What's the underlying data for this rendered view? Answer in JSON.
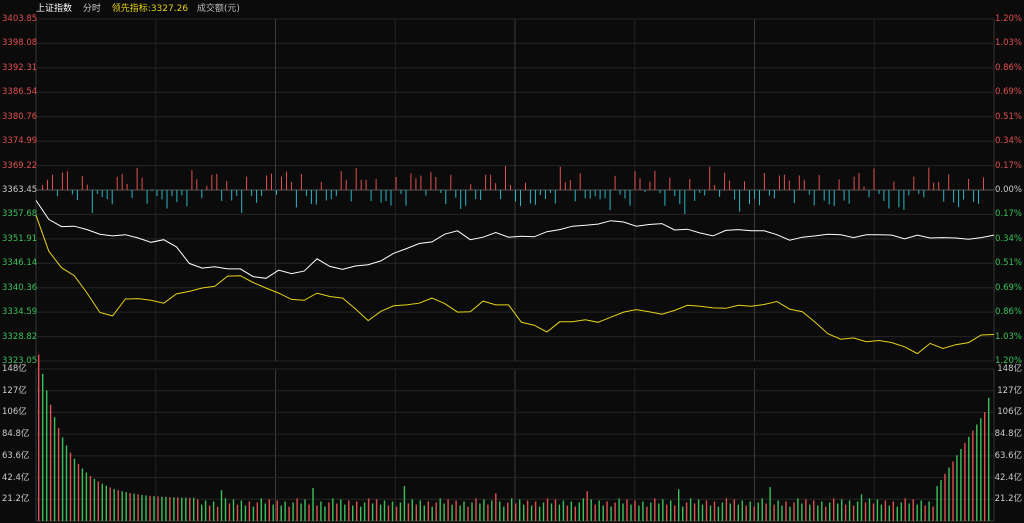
{
  "header": {
    "index_name": "上证指数",
    "mode": "分时",
    "leading_label": "领先指标:",
    "leading_value": "3327.26",
    "volume_label": "成交额(元)"
  },
  "colors": {
    "up": "#e05050",
    "down": "#2bb5c4",
    "index_line": "#ffffff",
    "leading_line": "#e6d21a",
    "vol_up": "#e05050",
    "vol_down": "#3cc05a"
  },
  "price_axis": {
    "left": [
      "3403.85",
      "3398.08",
      "3392.31",
      "3386.54",
      "3380.76",
      "3374.99",
      "3369.22",
      "3363.45",
      "3357.68",
      "3351.91",
      "3346.14",
      "3340.36",
      "3334.59",
      "3328.82",
      "3323.05"
    ],
    "right": [
      "1.20%",
      "1.03%",
      "0.86%",
      "0.69%",
      "0.51%",
      "0.34%",
      "0.17%",
      "0.00%",
      "0.17%",
      "0.34%",
      "0.51%",
      "0.69%",
      "0.86%",
      "1.03%",
      "1.20%"
    ]
  },
  "volume_axis": [
    "148亿",
    "127亿",
    "106亿",
    "84.8亿",
    "63.6亿",
    "42.4亿",
    "21.2亿"
  ],
  "chart_data": {
    "type": "line",
    "title": "上证指数 分时",
    "prev_close": 3363.45,
    "ylim": [
      3323.05,
      3403.85
    ],
    "series": [
      {
        "name": "上证指数",
        "values": [
          3361.0,
          3356.5,
          3354.8,
          3354.9,
          3354.1,
          3353.0,
          3352.6,
          3352.9,
          3352.1,
          3351.1,
          3351.7,
          3350.0,
          3346.1,
          3345.0,
          3345.3,
          3344.8,
          3344.8,
          3343.0,
          3342.6,
          3344.5,
          3343.7,
          3344.3,
          3347.2,
          3345.4,
          3344.7,
          3345.5,
          3345.8,
          3346.7,
          3348.5,
          3349.6,
          3350.8,
          3351.2,
          3353.0,
          3353.8,
          3351.7,
          3352.3,
          3353.4,
          3352.3,
          3352.5,
          3352.4,
          3353.6,
          3354.1,
          3354.9,
          3355.1,
          3355.4,
          3356.2,
          3355.9,
          3354.9,
          3355.3,
          3355.5,
          3354.0,
          3354.2,
          3353.3,
          3352.6,
          3353.9,
          3354.1,
          3353.8,
          3353.8,
          3352.9,
          3351.6,
          3352.3,
          3352.6,
          3353.0,
          3352.9,
          3352.2,
          3352.9,
          3352.9,
          3352.8,
          3351.9,
          3352.8,
          3352.1,
          3352.2,
          3352.1,
          3351.8,
          3352.2,
          3352.8
        ]
      },
      {
        "name": "领先指标",
        "values": [
          3357.5,
          3349.0,
          3345.1,
          3343.2,
          3339.1,
          3334.5,
          3333.7,
          3337.7,
          3337.8,
          3337.4,
          3336.7,
          3338.9,
          3339.5,
          3340.3,
          3340.7,
          3343.1,
          3343.2,
          3341.6,
          3340.3,
          3339.1,
          3337.6,
          3337.4,
          3339.1,
          3338.3,
          3337.9,
          3335.4,
          3332.6,
          3334.8,
          3336.1,
          3336.3,
          3336.7,
          3337.9,
          3336.6,
          3334.6,
          3334.7,
          3337.2,
          3336.3,
          3336.3,
          3332.2,
          3331.5,
          3329.9,
          3332.3,
          3332.3,
          3332.8,
          3332.2,
          3333.4,
          3334.6,
          3335.2,
          3334.7,
          3334.1,
          3335.0,
          3336.2,
          3336.0,
          3335.6,
          3335.5,
          3336.2,
          3336.0,
          3336.4,
          3337.1,
          3335.3,
          3334.7,
          3332.2,
          3329.5,
          3328.2,
          3328.5,
          3327.6,
          3327.9,
          3327.4,
          3326.4,
          3324.8,
          3327.2,
          3326.0,
          3326.9,
          3327.4,
          3329.2,
          3329.3
        ]
      }
    ],
    "volume_unit": "亿",
    "volume_ylim": [
      0,
      148
    ]
  }
}
